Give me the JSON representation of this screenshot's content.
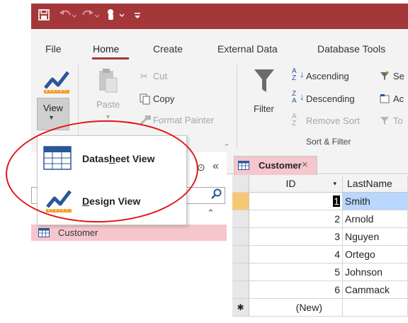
{
  "qat": {
    "icons": [
      "save-icon",
      "undo-icon",
      "redo-icon",
      "touch-mode-icon",
      "customize-icon"
    ]
  },
  "menu": {
    "tabs": [
      "File",
      "Home",
      "Create",
      "External Data",
      "Database Tools"
    ],
    "active_tab": "Home"
  },
  "ribbon": {
    "views": {
      "view_label": "View",
      "arrow": "▾"
    },
    "clipboard": {
      "paste_label": "Paste",
      "cut_label": "Cut",
      "copy_label": "Copy",
      "format_painter_label": "Format Painter"
    },
    "sort_filter": {
      "filter_label": "Filter",
      "ascending_label": "Ascending",
      "descending_label": "Descending",
      "remove_sort_label": "Remove Sort",
      "selection_partial": "Se",
      "advanced_partial": "Ac",
      "toggle_partial": "To",
      "group_label": "Sort & Filter"
    }
  },
  "view_dropdown": {
    "items": [
      {
        "label_before": "Datas",
        "label_underlined": "h",
        "label_after": "eet View"
      },
      {
        "label_before": "",
        "label_underlined": "D",
        "label_after": "esign View"
      }
    ]
  },
  "nav_pane": {
    "collapse_glyph": "«",
    "items": [
      "Customer"
    ]
  },
  "document": {
    "tab_label": "Customer",
    "columns": [
      "ID",
      "LastName"
    ],
    "rows": [
      {
        "id": "1",
        "last_name": "Smith"
      },
      {
        "id": "2",
        "last_name": "Arnold"
      },
      {
        "id": "3",
        "last_name": "Nguyen"
      },
      {
        "id": "4",
        "last_name": "Ortego"
      },
      {
        "id": "5",
        "last_name": "Johnson"
      },
      {
        "id": "6",
        "last_name": "Cammack"
      }
    ],
    "new_row_marker": "✱",
    "new_row_label": "(New)"
  },
  "colors": {
    "accent": "#a4373a",
    "highlight": "#f5c6cc",
    "annotation": "#e2151b"
  }
}
